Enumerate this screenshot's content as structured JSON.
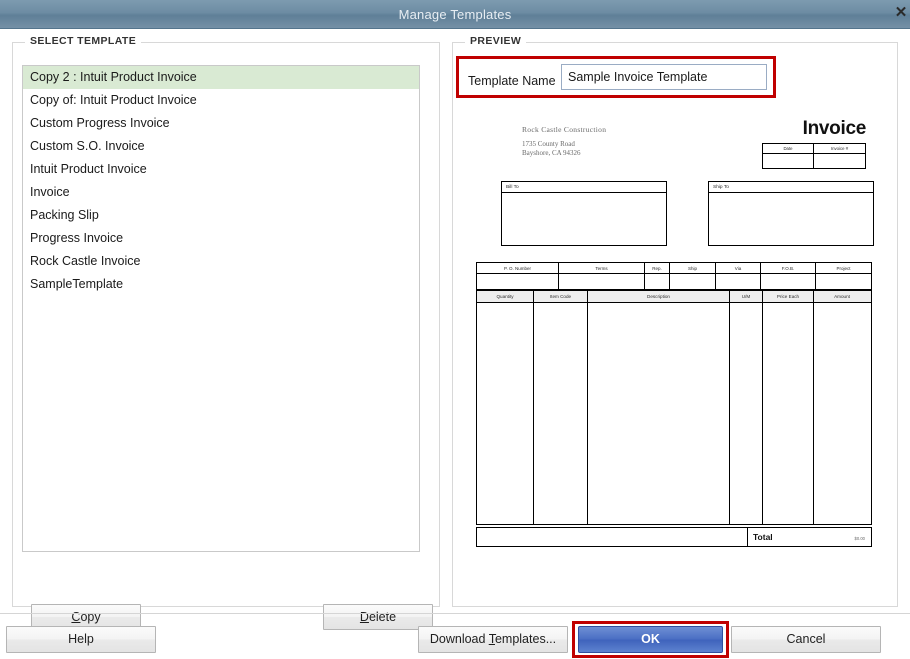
{
  "window": {
    "title": "Manage Templates",
    "close_icon": "close-icon",
    "close_glyph": "✕"
  },
  "select_template": {
    "legend": "SELECT TEMPLATE",
    "items": [
      {
        "label": "Copy 2 : Intuit Product Invoice",
        "selected": true
      },
      {
        "label": "Copy of: Intuit Product Invoice",
        "selected": false
      },
      {
        "label": "Custom Progress Invoice",
        "selected": false
      },
      {
        "label": "Custom S.O. Invoice",
        "selected": false
      },
      {
        "label": "Intuit Product Invoice",
        "selected": false
      },
      {
        "label": "Invoice",
        "selected": false
      },
      {
        "label": "Packing Slip",
        "selected": false
      },
      {
        "label": "Progress Invoice",
        "selected": false
      },
      {
        "label": "Rock Castle Invoice",
        "selected": false
      },
      {
        "label": "SampleTemplate",
        "selected": false
      }
    ],
    "copy_label": "Copy",
    "copy_accel": "C",
    "copy_rest": "opy",
    "delete_label": "Delete",
    "delete_accel": "D",
    "delete_rest": "elete"
  },
  "preview": {
    "legend": "PREVIEW",
    "template_name_label": "Template Name",
    "template_name_value": "Sample Invoice Template",
    "template_name_placeholder": "Template Name"
  },
  "invoice": {
    "company_name": "Rock Castle Construction",
    "address_line1": "1735 County Road",
    "address_line2": "Bayshore, CA 94326",
    "doc_title": "Invoice",
    "date_header": "Date",
    "invoice_number_header": "Invoice #",
    "bill_to_header": "Bill To",
    "ship_to_header": "Ship To",
    "terms_headers": [
      "P. O. Number",
      "Terms",
      "Rep.",
      "Ship",
      "Via",
      "F.O.B.",
      "Project"
    ],
    "item_headers": [
      "Quantity",
      "Item Code",
      "Description",
      "U/M",
      "Price Each",
      "Amount"
    ],
    "total_label": "Total",
    "total_amount": "$0.00"
  },
  "footer": {
    "help_label": "Help",
    "download_label": "Download Templates...",
    "download_accel_pre": "Download ",
    "download_accel": "T",
    "download_accel_post": "emplates...",
    "ok_label": "OK",
    "cancel_label": "Cancel"
  },
  "annotations": {
    "highlight_color": "#c00000",
    "template_name_highlight": "template-name-highlight",
    "ok_highlight": "ok-button-highlight"
  },
  "colors": {
    "titlebar": "#6d8ca3",
    "selection": "#d9ead3",
    "ok_button": "#4a6fc4",
    "annotation_red": "#c00000"
  }
}
